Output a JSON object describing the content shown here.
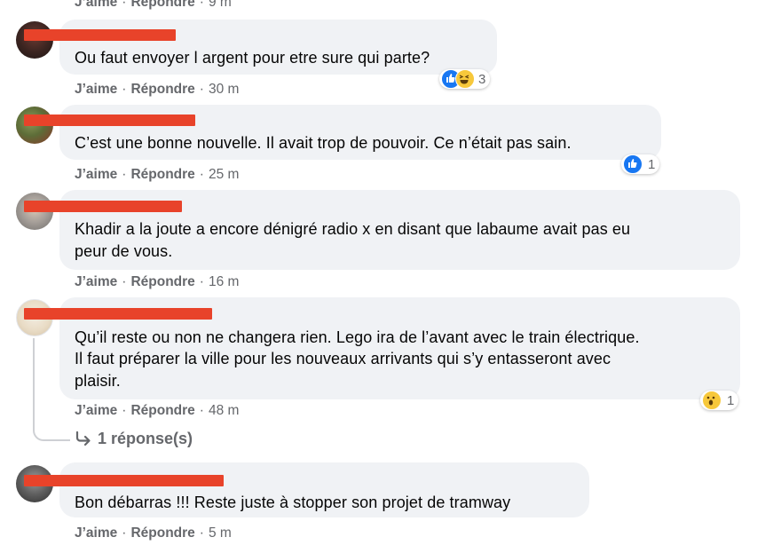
{
  "actions": {
    "like": "J’aime",
    "reply": "Répondre",
    "separator": "·"
  },
  "comments": [
    {
      "text_lines": [
        "Ou faut envoyer l argent pour etre sure qui parte?"
      ],
      "time": "30 m",
      "reaction_count": "3",
      "reaction_icons": [
        "like-icon",
        "laughing-icon"
      ]
    },
    {
      "text_lines": [
        "C’est une bonne nouvelle. Il avait trop de pouvoir. Ce n’était pas sain."
      ],
      "time": "25 m",
      "reaction_count": "1",
      "reaction_icons": [
        "like-icon"
      ]
    },
    {
      "text_lines": [
        "Khadir a la joute a encore dénigré radio x en disant que labaume avait pas eu",
        "peur de vous."
      ],
      "time": "16 m"
    },
    {
      "text_lines": [
        "Qu’il reste ou non ne changera rien. Lego ira de l’avant avec le train électrique.",
        "Il faut préparer la ville pour les nouveaux arrivants qui s’y entasseront avec",
        "plaisir."
      ],
      "time": "48 m",
      "reaction_count": "1",
      "reaction_icons": [
        "wow-icon"
      ],
      "replies_label": "1 réponse(s)"
    },
    {
      "text_lines": [
        "Bon débarras !!! Reste juste à stopper son projet de tramway"
      ],
      "time": "5 m"
    }
  ],
  "top_partial": {
    "time": "9 m"
  },
  "colors": {
    "bubble": "#f0f2f5",
    "redaction": "#e8432a",
    "meta": "#65676b",
    "like_blue": "#1877f2"
  }
}
